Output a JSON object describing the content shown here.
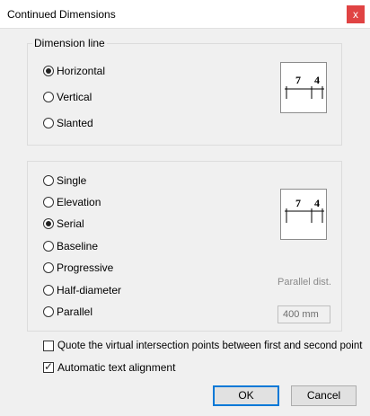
{
  "window": {
    "title": "Continued Dimensions",
    "close_glyph": "x"
  },
  "dimension_line": {
    "label": "Dimension line",
    "options": [
      "Horizontal",
      "Vertical",
      "Slanted"
    ],
    "selected": "Horizontal",
    "preview": {
      "left_value": "7",
      "right_value": "4"
    }
  },
  "type": {
    "options": [
      "Single",
      "Elevation",
      "Serial",
      "Baseline",
      "Progressive",
      "Half-diameter",
      "Parallel"
    ],
    "selected": "Serial",
    "preview": {
      "left_value": "7",
      "right_value": "4"
    },
    "parallel_label": "Parallel dist.",
    "parallel_value": "400 mm"
  },
  "checkboxes": {
    "quote_label": "Quote the virtual intersection points between first and second point",
    "quote_checked": false,
    "auto_label": "Automatic text alignment",
    "auto_checked": true
  },
  "buttons": {
    "ok": "OK",
    "cancel": "Cancel"
  }
}
